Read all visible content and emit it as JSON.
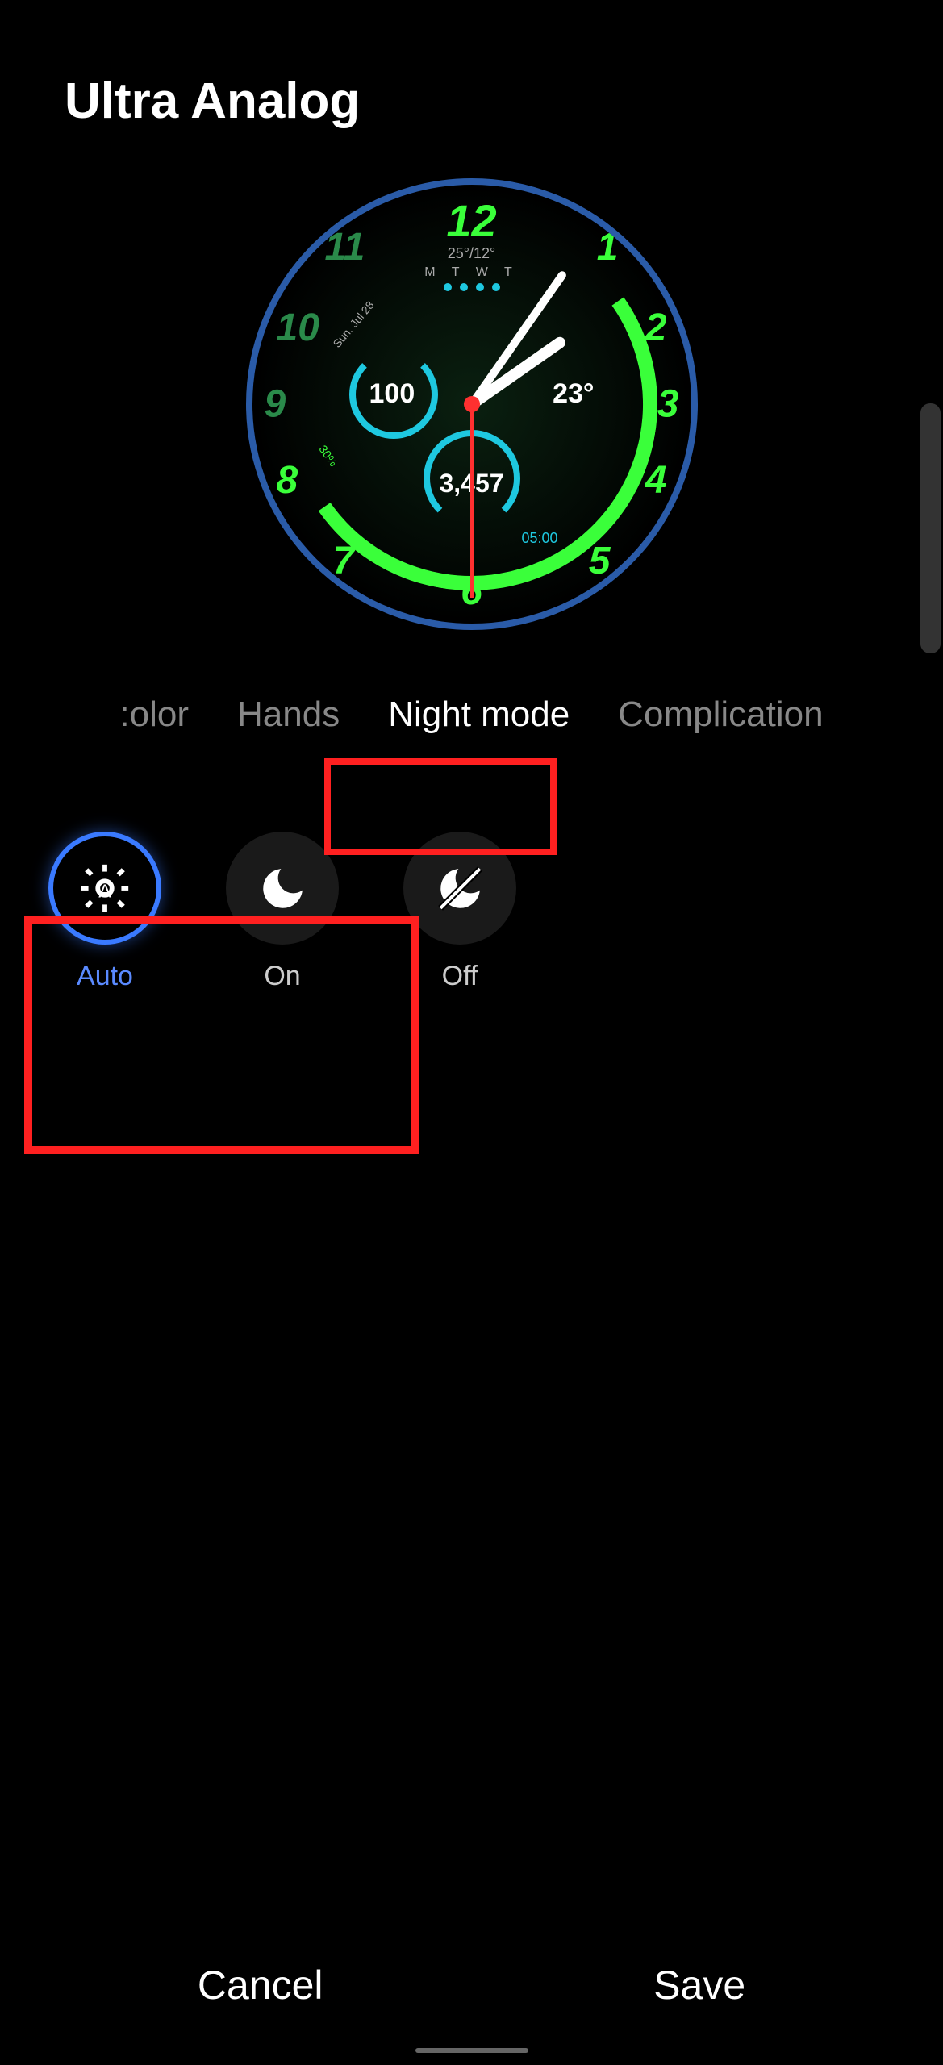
{
  "header": {
    "title": "Ultra Analog"
  },
  "watchFace": {
    "numbers": {
      "12": "12",
      "1": "1",
      "2": "2",
      "3": "3",
      "4": "4",
      "5": "5",
      "6": "6",
      "7": "7",
      "8": "8",
      "9": "9",
      "10": "10",
      "11": "11"
    },
    "complications": {
      "weather": "25°/12°",
      "daysOfWeek": "M T W T",
      "battery": "100",
      "temperature": "23°",
      "steps": "3,457",
      "sunset": "05:00",
      "date": "Sun, Jul 28",
      "percentage": "30%"
    }
  },
  "tabs": {
    "items": [
      {
        "label": ":olor",
        "active": false
      },
      {
        "label": "Hands",
        "active": false
      },
      {
        "label": "Night mode",
        "active": true
      },
      {
        "label": "Complication",
        "active": false
      }
    ]
  },
  "nightModeOptions": [
    {
      "key": "auto",
      "label": "Auto",
      "icon": "auto-brightness-icon",
      "selected": true
    },
    {
      "key": "on",
      "label": "On",
      "icon": "moon-icon",
      "selected": false
    },
    {
      "key": "off",
      "label": "Off",
      "icon": "moon-slash-icon",
      "selected": false
    }
  ],
  "footer": {
    "cancel": "Cancel",
    "save": "Save"
  },
  "annotations": {
    "highlightedTab": "Night mode",
    "highlightedOptions": [
      "Auto",
      "On"
    ]
  }
}
